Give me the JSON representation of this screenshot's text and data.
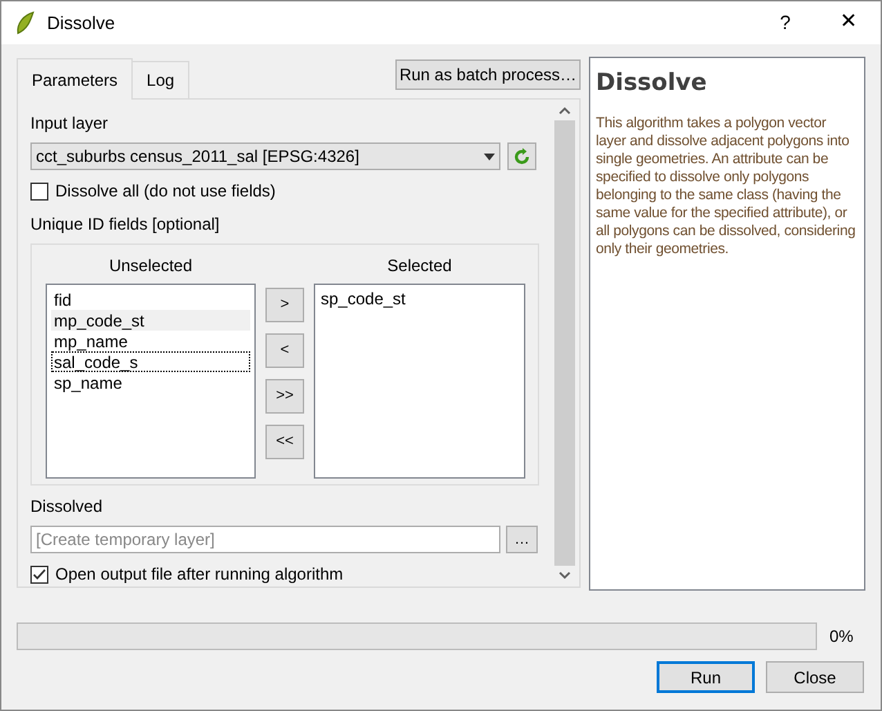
{
  "window": {
    "title": "Dissolve",
    "help_button": "?",
    "close_button": "✕"
  },
  "tabs": [
    {
      "label": "Parameters",
      "selected": true
    },
    {
      "label": "Log",
      "selected": false
    }
  ],
  "batch_button": "Run as batch process…",
  "input_layer": {
    "label": "Input layer",
    "value": "cct_suburbs census_2011_sal [EPSG:4326]"
  },
  "dissolve_all": {
    "label": "Dissolve all (do not use fields)",
    "checked": false
  },
  "unique_id": {
    "label": "Unique ID fields [optional]",
    "unselected_title": "Unselected",
    "unselected": [
      {
        "label": "fid",
        "hovered": false,
        "focused": false
      },
      {
        "label": "mp_code_st",
        "hovered": true,
        "focused": false
      },
      {
        "label": "mp_name",
        "hovered": false,
        "focused": false
      },
      {
        "label": "sal_code_s",
        "hovered": false,
        "focused": true
      },
      {
        "label": "sp_name",
        "hovered": false,
        "focused": false
      }
    ],
    "move_buttons": [
      ">",
      "<",
      ">>",
      "<<"
    ],
    "selected_title": "Selected",
    "selected": [
      {
        "label": "sp_code_st"
      }
    ]
  },
  "dissolved": {
    "label": "Dissolved",
    "placeholder": "[Create temporary layer]",
    "browse_button": "…"
  },
  "open_output": {
    "label": "Open output file after running algorithm",
    "checked": true
  },
  "help": {
    "title": "Dissolve",
    "text": "This algorithm takes a polygon vector layer and dissolve adjacent polygons into single geometries. An attribute can be specified to dissolve only polygons belonging to the same class (having the same value for the specified attribute), or all polygons can be dissolved, considering only their geometries."
  },
  "progress": {
    "level": 0,
    "reading": "0%"
  },
  "buttons": [
    {
      "label": "Run",
      "default": true
    },
    {
      "label": "Close",
      "default": false
    }
  ]
}
